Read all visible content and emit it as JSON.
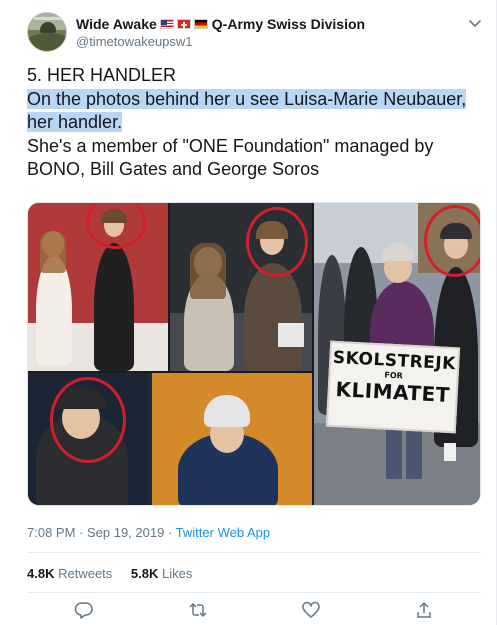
{
  "author": {
    "display_name": "Wide Awake",
    "name_suffix": "Q-Army Swiss Division",
    "handle": "@timetowakeupsw1",
    "flags": [
      "us-flag",
      "swiss-flag",
      "german-flag"
    ]
  },
  "tweet": {
    "lines": [
      "5. HER HANDLER",
      "On the photos behind her u see Luisa-Marie Neubauer,",
      "her handler.",
      "She's a member of \"ONE Foundation\" managed by",
      "BONO, Bill Gates and George Soros"
    ],
    "highlight_color": "#b9d6f5"
  },
  "media": {
    "sign_line1": "SKOLSTREJK",
    "sign_line2": "FOR",
    "sign_line3": "KLIMATET",
    "circle_color": "#d1202a"
  },
  "meta": {
    "time": "7:08 PM",
    "separator1": " · ",
    "date": "Sep 19, 2019",
    "separator2": " · ",
    "source": "Twitter Web App"
  },
  "stats": {
    "retweets_count": "4.8K",
    "retweets_label": "Retweets",
    "likes_count": "5.8K",
    "likes_label": "Likes"
  },
  "actions": [
    "reply-icon",
    "retweet-icon",
    "like-icon",
    "share-icon"
  ],
  "colors": {
    "text": "#14171a",
    "secondary": "#657786",
    "link": "#1b95e0",
    "divider": "#e6ecf0"
  }
}
